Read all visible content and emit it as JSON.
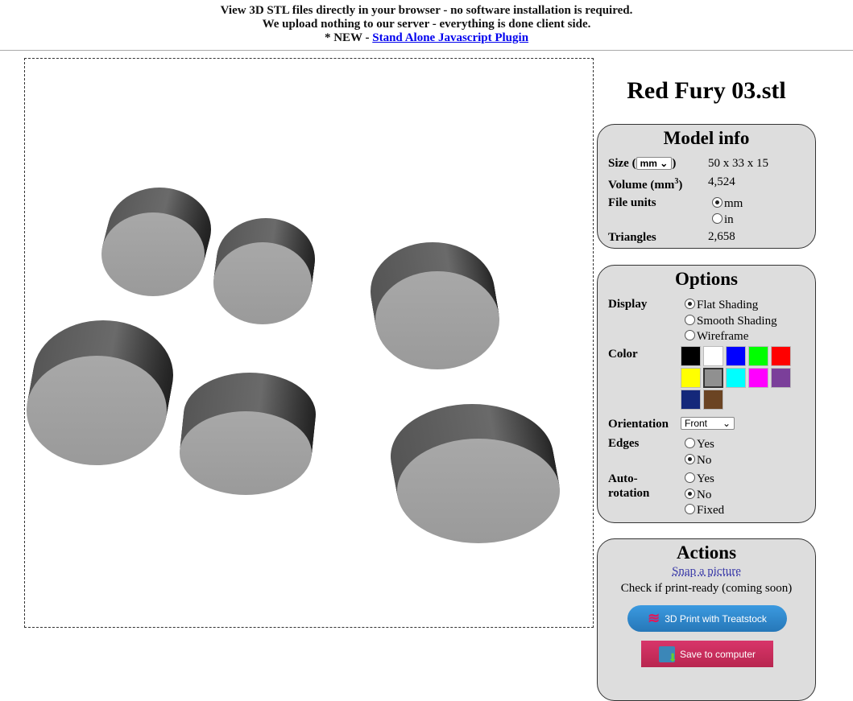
{
  "header": {
    "line1": "View 3D STL files directly in your browser - no software installation is required.",
    "line2": "We upload nothing to our server - everything is done client side.",
    "line3_prefix": "* NEW - ",
    "line3_link": "Stand Alone Javascript Plugin"
  },
  "file_title": "Red Fury 03.stl",
  "model_info": {
    "title": "Model info",
    "size_label_pre": "Size (",
    "size_unit": "mm",
    "size_label_post": ")",
    "size_value": "50 x 33 x 15",
    "volume_label": "Volume (mm",
    "volume_sup": "3",
    "volume_close": ")",
    "volume_value": "4,524",
    "file_units_label": "File units",
    "unit_mm": "mm",
    "unit_in": "in",
    "unit_selected": "mm",
    "triangles_label": "Triangles",
    "triangles_value": "2,658"
  },
  "options": {
    "title": "Options",
    "display_label": "Display",
    "display_options": [
      "Flat Shading",
      "Smooth Shading",
      "Wireframe"
    ],
    "display_selected": "Flat Shading",
    "color_label": "Color",
    "colors": [
      "#000000",
      "#ffffff",
      "#0000ff",
      "#00ff00",
      "#ff0000",
      "#ffff00",
      "#909090",
      "#00ffff",
      "#ff00ff",
      "#7b3f9a",
      "#14287a",
      "#6b4423"
    ],
    "color_selected": "#909090",
    "orientation_label": "Orientation",
    "orientation_value": "Front",
    "edges_label": "Edges",
    "edges_yes": "Yes",
    "edges_no": "No",
    "edges_selected": "No",
    "autorotation_label1": "Auto-",
    "autorotation_label2": "rotation",
    "auto_yes": "Yes",
    "auto_no": "No",
    "auto_fixed": "Fixed",
    "auto_selected": "No"
  },
  "actions": {
    "title": "Actions",
    "snap": "Snap a picture",
    "check": "Check if print-ready (coming soon)",
    "print_btn": "3D Print with Treatstock",
    "save_btn": "Save to computer"
  }
}
